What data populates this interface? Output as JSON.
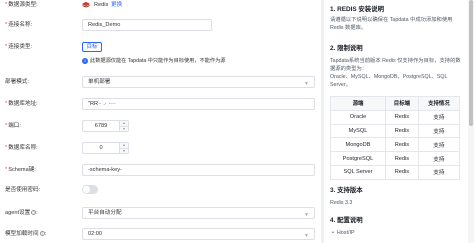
{
  "form": {
    "db_type": {
      "label": "数据源类型:",
      "value": "Redis",
      "change_link": "更换"
    },
    "connection_name": {
      "label": "连接名称:",
      "value": "Redis_Demo"
    },
    "connection_type": {
      "label": "连接类型:",
      "option": "目标"
    },
    "info_text": "此数据源仅能在 Tapdata 中只能作为目标使用，不能作为源",
    "deploy_mode": {
      "label": "部署模式:",
      "value": "单机部署"
    },
    "db_address": {
      "label": "数据库地址:",
      "value": "\"RR·· .· ····"
    },
    "port": {
      "label": "端口:",
      "value": "6789"
    },
    "db_name": {
      "label": "数据库名称:",
      "value": "0"
    },
    "schema_key": {
      "label": "Schema键:",
      "value": "-schema-key-"
    },
    "use_password": {
      "label": "是否使用密码:",
      "enabled": false
    },
    "agent_setting": {
      "label": "agent设置",
      "value": "平台自动分配"
    },
    "model_load_time": {
      "label": "模型加载时间",
      "value": "02:00"
    }
  },
  "doc": {
    "sec1_title": "1. REDIS 安装说明",
    "sec1_text": "请遵循以下说明以确保在 Tapdata 中成功添加和使用 Redis 数据库。",
    "sec2_title": "2. 限制说明",
    "sec2_text_1": "Tapdata系统当前版本 Redis 仅支持作为目标，支持的数据源的类型为：",
    "sec2_text_2": "Oracle、MySQL、MongoDB、PostgreSQL、SQL Server。",
    "table": {
      "headers": [
        "源端",
        "目标端",
        "支持情况"
      ],
      "rows": [
        [
          "Oracle",
          "Redis",
          "支持"
        ],
        [
          "MySQL",
          "Redis",
          "支持"
        ],
        [
          "MongoDB",
          "Redis",
          "支持"
        ],
        [
          "PostgreSQL",
          "Redis",
          "支持"
        ],
        [
          "SQL Server",
          "Redis",
          "支持"
        ]
      ]
    },
    "sec3_title": "3. 支持版本",
    "sec3_text": "Redis 3.3",
    "sec4_title": "4. 配置说明",
    "sec4_items": [
      "Host/IP"
    ]
  },
  "colors": {
    "accent": "#2c65ff",
    "required": "#e5484d",
    "redis_red": "#d82c20"
  },
  "icons": {
    "redis_logo": "redis-logo-icon",
    "info": "info-icon",
    "help": "question-circle-icon",
    "caret": "chevron-down-icon"
  }
}
